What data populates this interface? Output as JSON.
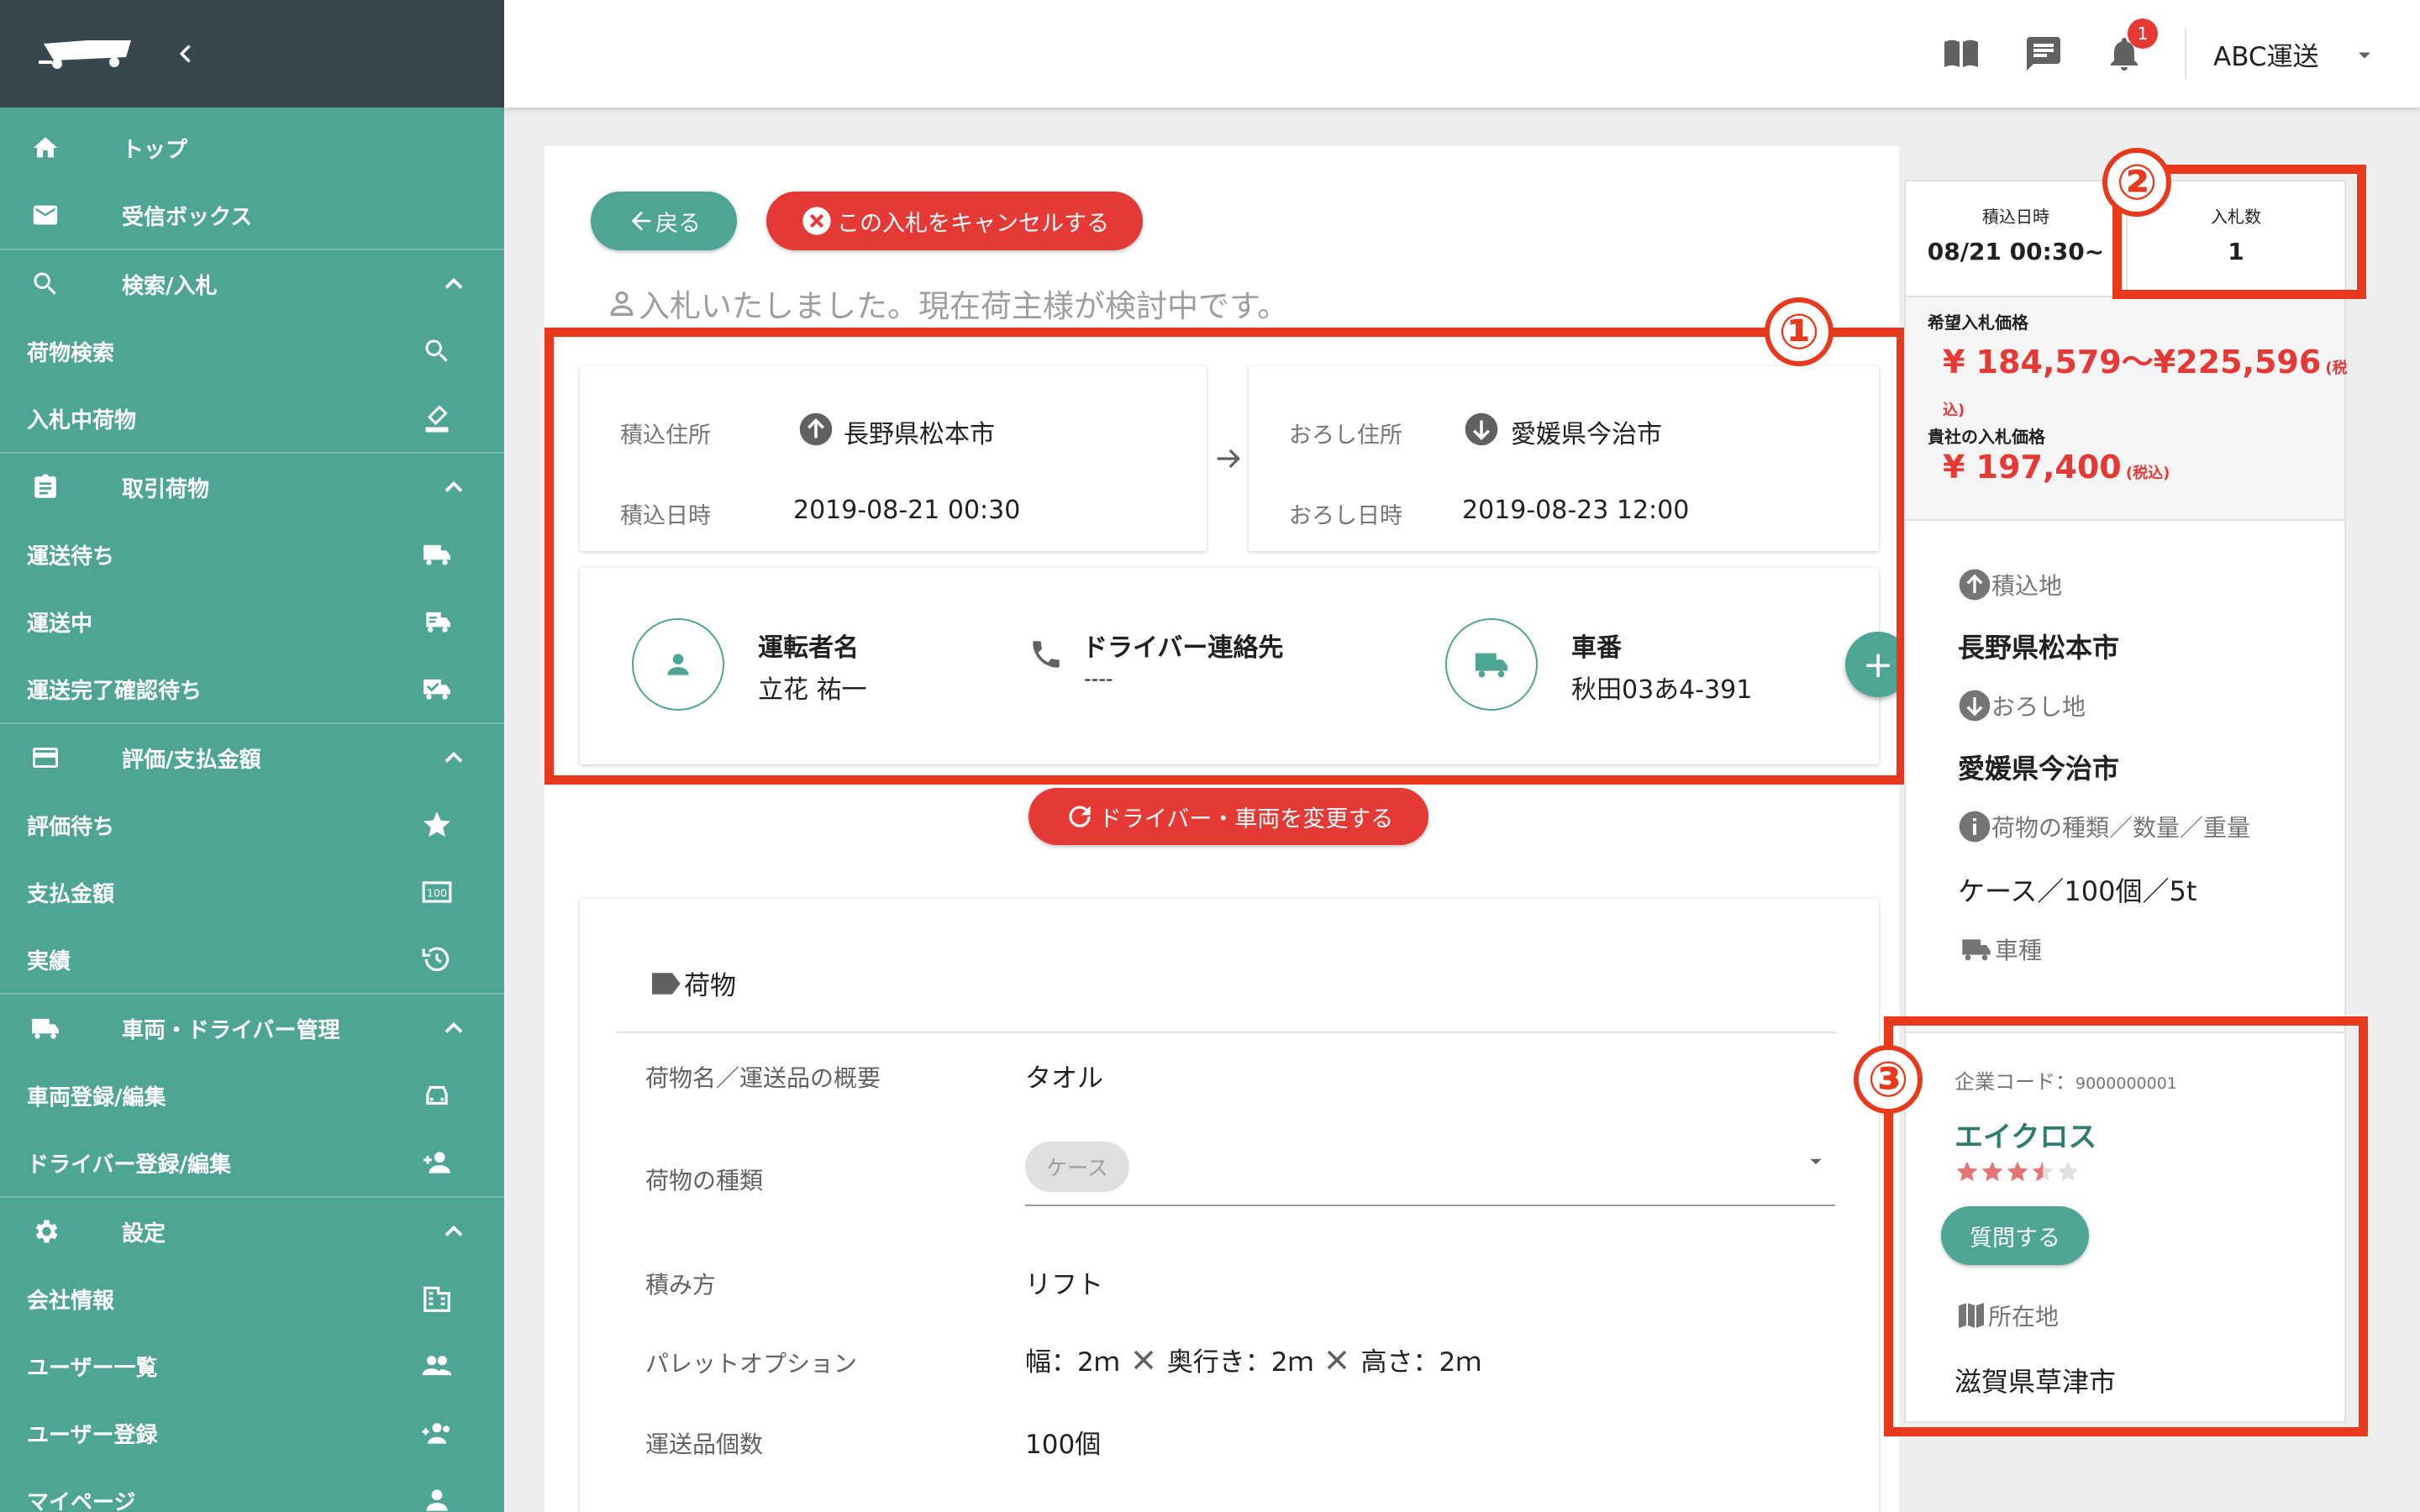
{
  "sidebar": {
    "sections": [
      {
        "label": "トップ",
        "icon": "home-icon"
      },
      {
        "label": "受信ボックス",
        "icon": "mail-icon"
      },
      {
        "label": "検索/入札",
        "icon": "search-icon",
        "items": [
          {
            "label": "荷物検索",
            "icon": "search-icon"
          },
          {
            "label": "入札中荷物",
            "icon": "gavel-icon"
          }
        ]
      },
      {
        "label": "取引荷物",
        "icon": "clipboard-icon",
        "items": [
          {
            "label": "運送待ち",
            "icon": "truck-icon"
          },
          {
            "label": "運送中",
            "icon": "truck-fast-icon"
          },
          {
            "label": "運送完了確認待ち",
            "icon": "truck-check-icon"
          }
        ]
      },
      {
        "label": "評価/支払金額",
        "icon": "card-icon",
        "items": [
          {
            "label": "評価待ち",
            "icon": "star-icon"
          },
          {
            "label": "支払金額",
            "icon": "money-icon"
          },
          {
            "label": "実績",
            "icon": "history-icon"
          }
        ]
      },
      {
        "label": "車両・ドライバー管理",
        "icon": "truck-icon",
        "items": [
          {
            "label": "車両登録/編集",
            "icon": "car-icon"
          },
          {
            "label": "ドライバー登録/編集",
            "icon": "person-add-icon"
          }
        ]
      },
      {
        "label": "設定",
        "icon": "gear-icon",
        "items": [
          {
            "label": "会社情報",
            "icon": "building-icon"
          },
          {
            "label": "ユーザー一覧",
            "icon": "people-icon"
          },
          {
            "label": "ユーザー登録",
            "icon": "group-add-icon"
          },
          {
            "label": "マイページ",
            "icon": "person-icon"
          }
        ]
      }
    ]
  },
  "header": {
    "company": "ABC運送",
    "notification_count": "1"
  },
  "main": {
    "back_label": "戻る",
    "cancel_label": "この入札をキャンセルする",
    "status_text": "入札いたしました。現在荷主様が検討中です。",
    "pickup": {
      "address_label": "積込住所",
      "address_value": "長野県松本市",
      "date_label": "積込日時",
      "date_value": "2019-08-21 00:30"
    },
    "dropoff": {
      "address_label": "おろし住所",
      "address_value": "愛媛県今治市",
      "date_label": "おろし日時",
      "date_value": "2019-08-23 12:00"
    },
    "driver": {
      "name_label": "運転者名",
      "name_value": "立花 祐一",
      "contact_label": "ドライバー連絡先",
      "contact_value": "----",
      "plate_label": "車番",
      "plate_value": "秋田03あ4-391"
    },
    "change_driver_label": "ドライバー・車両を変更する",
    "cargo": {
      "section_title": "荷物",
      "rows": [
        {
          "label": "荷物名／運送品の概要",
          "value": "タオル"
        },
        {
          "label": "荷物の種類",
          "value": "ケース"
        },
        {
          "label": "積み方",
          "value": "リフト"
        },
        {
          "label": "パレットオプション",
          "value": ""
        },
        {
          "label": "運送品個数",
          "value": "100個"
        }
      ],
      "pallet": {
        "width_label": "幅：2ｍ",
        "depth_label": "奥行き：2ｍ",
        "height_label": "高さ：2ｍ"
      }
    }
  },
  "info": {
    "pickup_time_label": "積込日時",
    "pickup_time_value": "08/21 00:30~",
    "bid_count_label": "入札数",
    "bid_count_value": "1",
    "desired_price_label": "希望入札価格",
    "desired_price_value": "¥ 184,579〜¥225,596",
    "desired_price_note_a": "(税",
    "desired_price_note_b": "込)",
    "your_price_label": "貴社の入札価格",
    "your_price_value": "¥ 197,400",
    "your_price_note": "(税込)",
    "origin_label": "積込地",
    "origin_value": "長野県松本市",
    "dest_label": "おろし地",
    "dest_value": "愛媛県今治市",
    "cargo_type_label": "荷物の種類／数量／重量",
    "cargo_type_value": "ケース／100個／5t",
    "vehicle_label": "車種",
    "company_code_label": "企業コード：",
    "company_code_value": "9000000001",
    "shipper_name": "エイクロス",
    "rating": 3.5,
    "question_label": "質問する",
    "location_label": "所在地",
    "location_value": "滋賀県草津市"
  },
  "annotations": {
    "mark1": "①",
    "mark2": "②",
    "mark3": "③"
  },
  "colors": {
    "accent": "#4ea596",
    "danger": "#e53935",
    "annotation": "#e8391d",
    "sidebar_header": "#37474f"
  }
}
